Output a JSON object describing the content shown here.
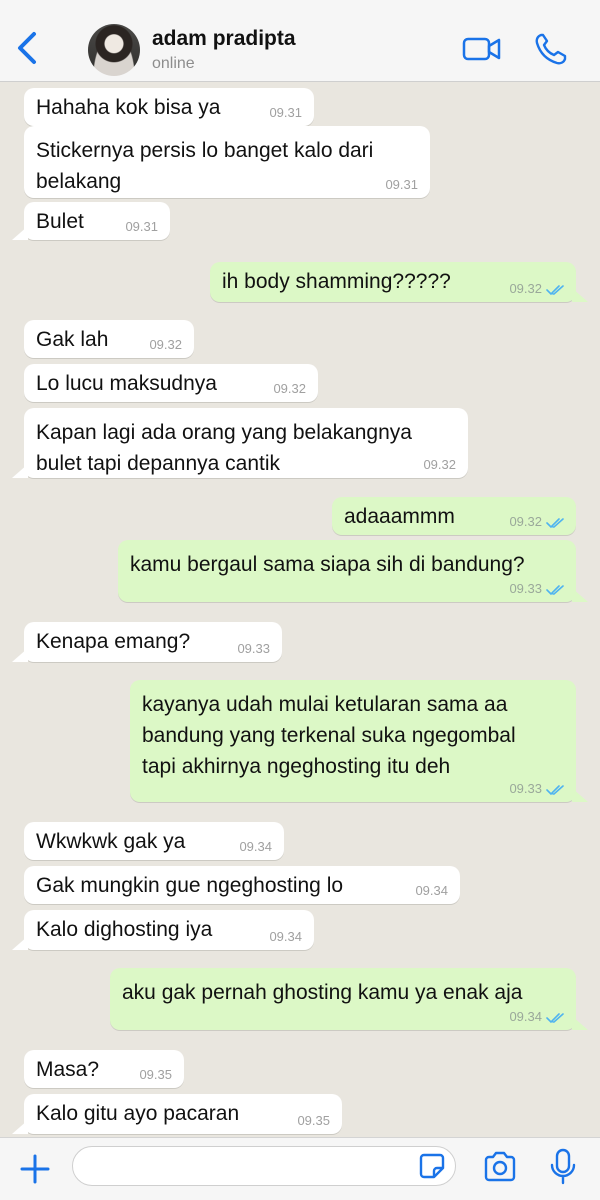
{
  "header": {
    "contact_name": "adam pradipta",
    "status": "online"
  },
  "composer": {
    "placeholder": ""
  },
  "colors": {
    "accent": "#1a73e8",
    "incoming_bubble": "#ffffff",
    "outgoing_bubble": "#dcf8c6",
    "chat_background": "#e9e6df",
    "read_tick": "#4fb3f0"
  },
  "messages": [
    {
      "dir": "in",
      "lines": [
        "Hahaha kok bisa ya"
      ],
      "time": "09.31"
    },
    {
      "dir": "in",
      "lines": [
        "Stickernya persis lo banget kalo dari",
        "belakang"
      ],
      "time": "09.31"
    },
    {
      "dir": "in",
      "lines": [
        "Bulet"
      ],
      "time": "09.31"
    },
    {
      "dir": "out",
      "lines": [
        "ih body shamming?????"
      ],
      "time": "09.32",
      "status": "read"
    },
    {
      "dir": "in",
      "lines": [
        "Gak lah"
      ],
      "time": "09.32"
    },
    {
      "dir": "in",
      "lines": [
        "Lo lucu maksudnya"
      ],
      "time": "09.32"
    },
    {
      "dir": "in",
      "lines": [
        "Kapan lagi ada orang yang belakangnya",
        "bulet tapi depannya cantik"
      ],
      "time": "09.32"
    },
    {
      "dir": "out",
      "lines": [
        "adaaammm"
      ],
      "time": "09.32",
      "status": "read"
    },
    {
      "dir": "out",
      "lines": [
        "kamu bergaul sama siapa sih di bandung?"
      ],
      "time": "09.33",
      "status": "read"
    },
    {
      "dir": "in",
      "lines": [
        "Kenapa emang?"
      ],
      "time": "09.33"
    },
    {
      "dir": "out",
      "lines": [
        "kayanya udah mulai ketularan sama aa",
        "bandung yang terkenal suka ngegombal",
        "tapi akhirnya ngeghosting itu deh"
      ],
      "time": "09.33",
      "status": "read"
    },
    {
      "dir": "in",
      "lines": [
        "Wkwkwk gak ya"
      ],
      "time": "09.34"
    },
    {
      "dir": "in",
      "lines": [
        "Gak mungkin gue ngeghosting lo"
      ],
      "time": "09.34"
    },
    {
      "dir": "in",
      "lines": [
        "Kalo dighosting iya"
      ],
      "time": "09.34"
    },
    {
      "dir": "out",
      "lines": [
        "aku gak pernah ghosting kamu ya enak aja"
      ],
      "time": "09.34",
      "status": "read"
    },
    {
      "dir": "in",
      "lines": [
        "Masa?"
      ],
      "time": "09.35"
    },
    {
      "dir": "in",
      "lines": [
        "Kalo gitu ayo pacaran"
      ],
      "time": "09.35"
    }
  ]
}
